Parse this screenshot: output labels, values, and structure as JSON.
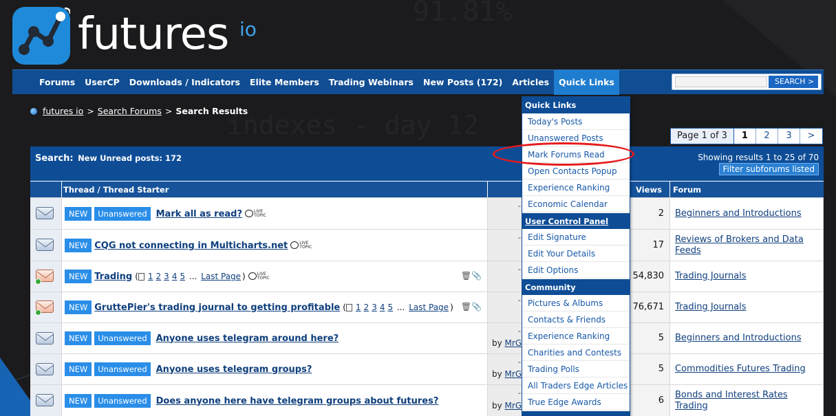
{
  "logo": {
    "brand": "futures",
    "tld": "io"
  },
  "nav": {
    "items": [
      "Forums",
      "UserCP",
      "Downloads / Indicators",
      "Elite Members",
      "Trading Webinars",
      "New Posts (172)",
      "Articles",
      "Quick Links"
    ],
    "search_button": "SEARCH  >"
  },
  "breadcrumb": {
    "home": "futures io",
    "search": "Search Forums",
    "current": "Search Results"
  },
  "pagination": {
    "label": "Page 1 of 3",
    "pages": [
      "1",
      "2",
      "3",
      ">"
    ]
  },
  "results": {
    "title": "Search:",
    "subtitle": "New Unread posts: 172",
    "count": "Showing results 1 to 25 of 70",
    "filter_button": "Filter subforums listed",
    "columns": {
      "thread": "Thread / Thread Starter",
      "views": "Views",
      "forum": "Forum"
    },
    "rows": [
      {
        "new": "NEW",
        "unanswered": "Unanswered",
        "title": "Mark all as read?",
        "live": true,
        "views": "2",
        "forum": "Beginners and Introductions",
        "by": ""
      },
      {
        "new": "NEW",
        "unanswered": "",
        "title": "CQG not connecting in Multicharts.net",
        "live": true,
        "views": "17",
        "forum": "Reviews of Brokers and Data Feeds",
        "by": ""
      },
      {
        "new": "NEW",
        "unanswered": "",
        "title": "Trading",
        "pages": [
          "1",
          "2",
          "3",
          "4",
          "5"
        ],
        "last_page": "Last Page",
        "live": true,
        "views": "54,830",
        "forum": "Trading Journals",
        "by": ""
      },
      {
        "new": "NEW",
        "unanswered": "",
        "title": "GruttePier's trading journal to getting profitable",
        "pages": [
          "1",
          "2",
          "3",
          "4",
          "5"
        ],
        "last_page": "Last Page",
        "live": false,
        "views": "76,671",
        "forum": "Trading Journals",
        "by": ""
      },
      {
        "new": "NEW",
        "unanswered": "Unanswered",
        "title": "Anyone uses telegram around here?",
        "live": false,
        "views": "5",
        "forum": "Beginners and Introductions",
        "by": "MrG"
      },
      {
        "new": "NEW",
        "unanswered": "Unanswered",
        "title": "Anyone uses telegram groups?",
        "live": false,
        "views": "5",
        "forum": "Commodities Futures Trading",
        "by": "MrG"
      },
      {
        "new": "NEW",
        "unanswered": "Unanswered",
        "title": "Does anyone here have telegram groups about futures?",
        "live": false,
        "views": "6",
        "forum": "Bonds and Interest Rates Trading",
        "by": "MrG"
      }
    ]
  },
  "live_label": {
    "top": "LIVE",
    "bottom": "TOPIC"
  },
  "by_prefix": "by",
  "dropdown": {
    "sections": [
      {
        "title": "Quick Links",
        "items": [
          "Today's Posts",
          "Unanswered Posts",
          "Mark Forums Read",
          "Open Contacts Popup",
          "Experience Ranking",
          "Economic Calendar"
        ]
      },
      {
        "title": "User Control Panel",
        "items": [
          "Edit Signature",
          "Edit Your Details",
          "Edit Options"
        ]
      },
      {
        "title": "Community",
        "items": [
          "Pictures & Albums",
          "Contacts & Friends",
          "Experience Ranking",
          "Charities and Contests",
          "Trading Polls",
          "All Traders Edge Articles",
          "True Edge Awards"
        ]
      }
    ]
  },
  "background_text": [
    "91.81%",
    "indexes - day 12"
  ],
  "colors": {
    "nav": "#104d93",
    "panel_head": "#0e4d96",
    "badge": "#2a8ee8",
    "annotation": "#e5191b"
  }
}
